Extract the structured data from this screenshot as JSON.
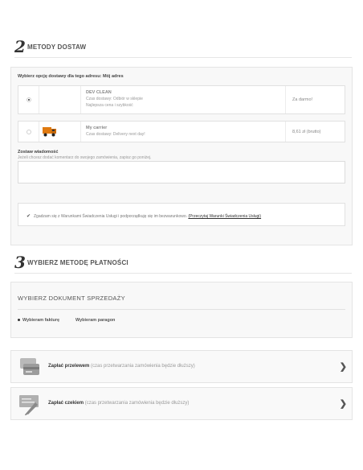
{
  "step2": {
    "number": "2",
    "title": "METODY DOSTAW"
  },
  "delivery": {
    "choose_label": "Wybierz opcję dostawy dla tego adresu: Mój adres",
    "options": [
      {
        "name": "DEV CLEAN",
        "line1": "Czas dostawy: Odbiór w sklepie",
        "line2": "Najlepsza cena i szybkość",
        "price": "Za darmo!",
        "selected": true
      },
      {
        "name": "My carrier",
        "line1": "Czas dostawy: Delivery next day!",
        "line2": "",
        "price": "8,61 zł (brutto)",
        "selected": false
      }
    ],
    "message_label": "Zostaw wiadomość",
    "message_hint": "Jeżeli chcesz dodać komentarz do swojego zamówienia, zapisz go poniżej.",
    "terms_text": "Zgadzam się z Warunkami Świadczenia Usługi i podporządkuję się im bezwarunkowo.",
    "terms_link": "(Przeczytaj Warunki Świadczenia Usługi)",
    "terms_checked": true
  },
  "step3": {
    "number": "3",
    "title": "WYBIERZ METODĘ PŁATNOŚCI"
  },
  "document": {
    "title": "WYBIERZ DOKUMENT SPRZEDAŻY",
    "options": [
      "Wybieram fakturę",
      "Wybieram paragon"
    ],
    "selected_index": 0
  },
  "payments": [
    {
      "name": "Zapłać przelewem",
      "note": "(czas przetwarzania zamówienia będzie dłuższy)",
      "icon": "bank-card-icon"
    },
    {
      "name": "Zapłać czekiem",
      "note": "(czas przetwarzania zamówienia będzie dłuższy)",
      "icon": "cheque-icon"
    }
  ],
  "colors": {
    "panel_bg": "#f8f8f8",
    "border": "#e4e4e4",
    "truck_orange": "#e07a10"
  }
}
